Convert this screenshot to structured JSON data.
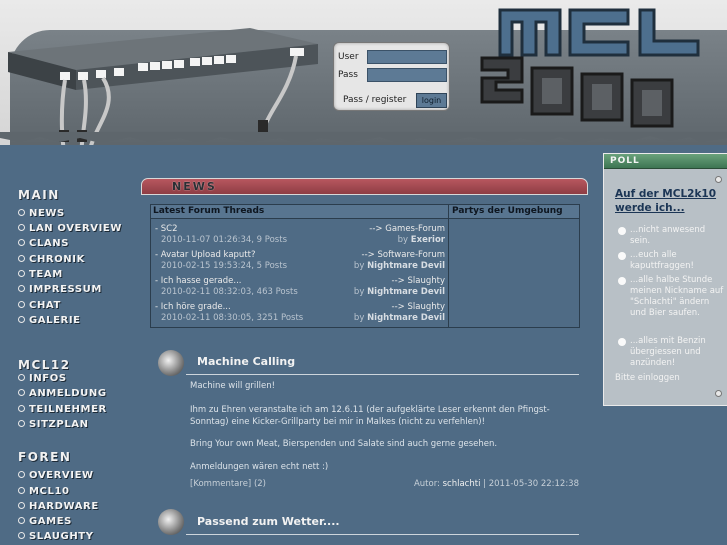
{
  "login": {
    "user_label": "User",
    "pass_label": "Pass",
    "pass_register": "Pass / register",
    "login_button": "login"
  },
  "logo": {
    "top": "MCL",
    "bottom": "2000"
  },
  "nav": {
    "main": {
      "heading": "MAIN",
      "items": [
        "NEWS",
        "LAN OVERVIEW",
        "CLANS",
        "CHRONIK",
        "TEAM",
        "IMPRESSUM",
        "CHAT",
        "GALERIE"
      ]
    },
    "mcl12": {
      "heading": "MCL12",
      "items": [
        "INFOS",
        "ANMELDUNG",
        "TEILNEHMER",
        "SITZPLAN"
      ]
    },
    "foren": {
      "heading": "FOREN",
      "items": [
        "OVERVIEW",
        "MCL10",
        "HARDWARE",
        "GAMES",
        "SLAUGHTY"
      ]
    }
  },
  "news": {
    "heading": "NEWS"
  },
  "threads": {
    "title": "Latest Forum Threads",
    "parties_title": "Partys der Umgebung",
    "items": [
      {
        "title": "- SC2",
        "forum": "--> Games-Forum",
        "meta": "2010-11-07 01:26:34, 9 Posts",
        "by": "by",
        "author": "Exerior"
      },
      {
        "title": "- Avatar Upload kaputt?",
        "forum": "--> Software-Forum",
        "meta": "2010-02-15 19:53:24, 5 Posts",
        "by": "by",
        "author": "Nightmare Devil"
      },
      {
        "title": "- Ich hasse gerade...",
        "forum": "--> Slaughty",
        "meta": "2010-02-11 08:32:03, 463 Posts",
        "by": "by",
        "author": "Nightmare Devil"
      },
      {
        "title": "- Ich höre grade...",
        "forum": "--> Slaughty",
        "meta": "2010-02-11 08:30:05, 3251 Posts",
        "by": "by",
        "author": "Nightmare Devil"
      }
    ]
  },
  "posts": [
    {
      "title": "Machine Calling",
      "paragraphs": [
        "Machine will grillen!",
        "Ihm zu Ehren veranstalte ich am 12.6.11 (der aufgeklärte Leser erkennt den Pfingst-Sonntag) eine Kicker-Grillparty bei mir in Malkes (nicht zu verfehlen)!",
        "Bring Your own Meat, Bierspenden und Salate sind auch gerne gesehen.",
        "Anmeldungen wären echt nett :)"
      ],
      "comments": "[Kommentare] (2)",
      "author_label": "Autor:",
      "author": "schlachti",
      "date": "| 2011-05-30 22:12:38"
    },
    {
      "title": "Passend zum Wetter...."
    }
  ],
  "poll": {
    "label": "POLL",
    "question": "Auf der MCL2k10 werde ich...",
    "options": [
      "...nicht anwesend sein.",
      "...euch alle kaputtfraggen!",
      "...alle halbe Stunde meinen Nickname auf \"Schlachti\" ändern und Bier saufen.",
      "...alles mit Benzin übergiessen und anzünden!"
    ],
    "login_note": "Bitte einloggen"
  }
}
